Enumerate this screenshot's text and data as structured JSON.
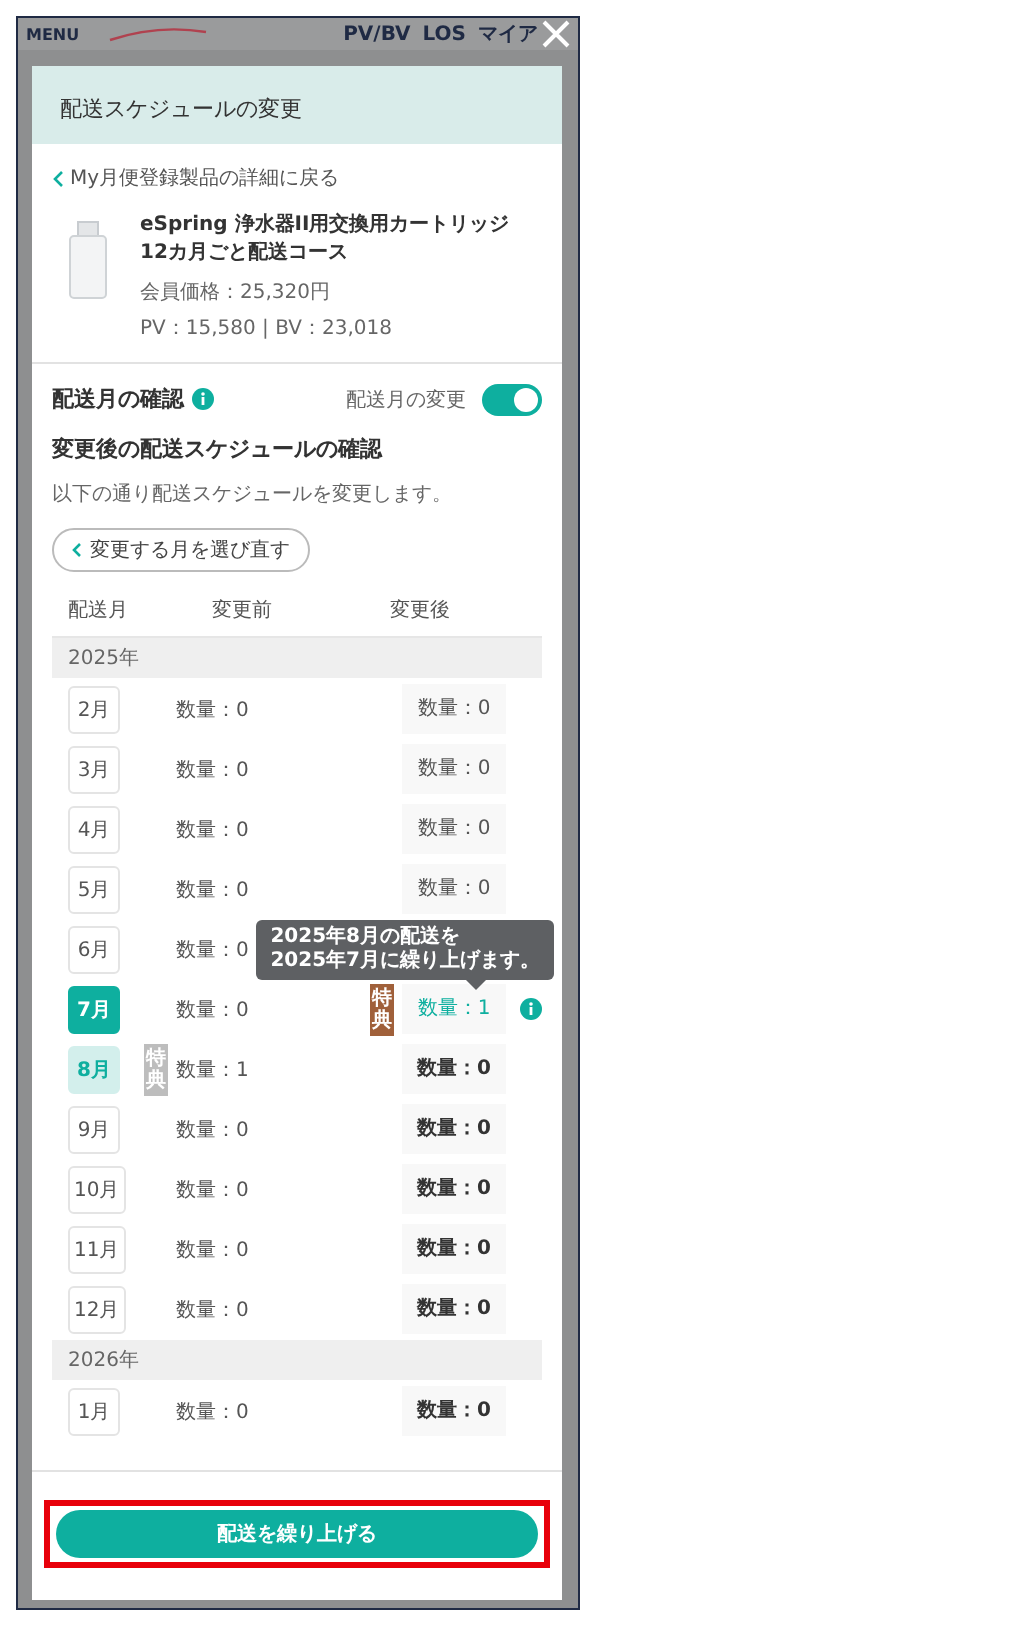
{
  "top_bar": {
    "menu": "MENU",
    "links": [
      "PV/BV",
      "LOS",
      "マイア"
    ]
  },
  "modal": {
    "title": "配送スケジュールの変更"
  },
  "back_link": "My月便登録製品の詳細に戻る",
  "product": {
    "name": "eSpring 浄水器II用交換用カートリッジ 12カ月ごと配送コース",
    "price": "会員価格：25,320円",
    "points": "PV：15,580 | BV：23,018"
  },
  "section": {
    "title": "配送月の確認",
    "toggle": {
      "label": "配送月の変更",
      "on": true
    }
  },
  "subtitle": "変更後の配送スケジュールの確認",
  "description": "以下の通り配送スケジュールを変更します。",
  "reselect_button": "変更する月を選び直す",
  "columns": [
    "配送月",
    "変更前",
    "変更後"
  ],
  "groups": [
    {
      "year": "2025年",
      "rows": [
        {
          "month": "2月",
          "kind": "normal",
          "before": "数量：0",
          "after": "数量：0",
          "changed": false,
          "bold": false
        },
        {
          "month": "3月",
          "kind": "normal",
          "before": "数量：0",
          "after": "数量：0",
          "changed": false,
          "bold": false
        },
        {
          "month": "4月",
          "kind": "normal",
          "before": "数量：0",
          "after": "数量：0",
          "changed": false,
          "bold": false
        },
        {
          "month": "5月",
          "kind": "normal",
          "before": "数量：0",
          "after": "数量：0",
          "changed": false,
          "bold": false
        },
        {
          "month": "6月",
          "kind": "normal",
          "before": "数量：0"
        },
        {
          "month": "7月",
          "kind": "target",
          "before": "数量：0",
          "after_badge": "特典",
          "after": "数量：1",
          "changed": true,
          "bold": false,
          "info": true,
          "tooltip": "2025年8月の配送を\n2025年7月に繰り上げます。"
        },
        {
          "month": "8月",
          "kind": "source",
          "before_badge": "特典",
          "before": "数量：1",
          "after": "数量：0",
          "changed": false,
          "bold": true
        },
        {
          "month": "9月",
          "kind": "normal",
          "before": "数量：0",
          "after": "数量：0",
          "changed": false,
          "bold": true
        },
        {
          "month": "10月",
          "kind": "normal",
          "before": "数量：0",
          "after": "数量：0",
          "changed": false,
          "bold": true
        },
        {
          "month": "11月",
          "kind": "normal",
          "before": "数量：0",
          "after": "数量：0",
          "changed": false,
          "bold": true
        },
        {
          "month": "12月",
          "kind": "normal",
          "before": "数量：0",
          "after": "数量：0",
          "changed": false,
          "bold": true
        }
      ]
    },
    {
      "year": "2026年",
      "rows": [
        {
          "month": "1月",
          "kind": "normal",
          "before": "数量：0",
          "after": "数量：0",
          "changed": false,
          "bold": true
        }
      ]
    }
  ],
  "submit_button": "配送を繰り上げる"
}
